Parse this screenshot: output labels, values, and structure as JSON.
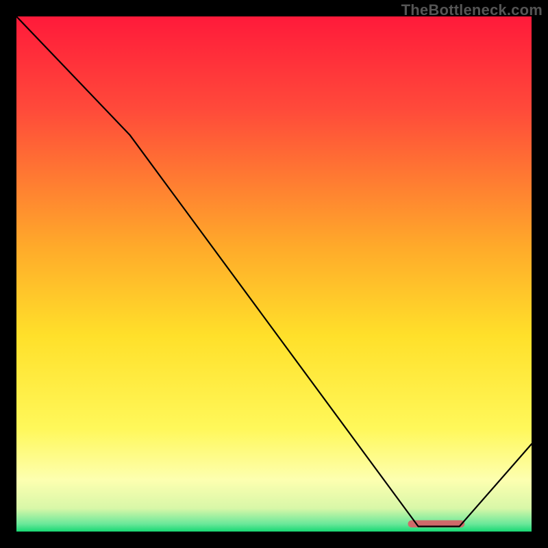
{
  "watermark": "TheBottleneck.com",
  "chart_data": {
    "type": "line",
    "title": "",
    "xlabel": "",
    "ylabel": "",
    "xlim": [
      0,
      100
    ],
    "ylim": [
      0,
      100
    ],
    "grid": false,
    "legend": false,
    "series": [
      {
        "name": "bottleneck-curve",
        "x": [
          0,
          22,
          78,
          86,
          100
        ],
        "values": [
          100,
          77,
          1,
          1,
          17
        ]
      }
    ],
    "marker": {
      "name": "optimal-range",
      "x_start": 76,
      "x_end": 87,
      "y": 1.5,
      "color": "#cf6a6a"
    },
    "background_gradient_stops": [
      {
        "offset": 0.0,
        "color": "#ff1a3a"
      },
      {
        "offset": 0.18,
        "color": "#ff4a3a"
      },
      {
        "offset": 0.45,
        "color": "#ffab2a"
      },
      {
        "offset": 0.62,
        "color": "#ffe02a"
      },
      {
        "offset": 0.8,
        "color": "#fff85a"
      },
      {
        "offset": 0.9,
        "color": "#fdffb0"
      },
      {
        "offset": 0.955,
        "color": "#d8f7a8"
      },
      {
        "offset": 0.985,
        "color": "#6be89a"
      },
      {
        "offset": 1.0,
        "color": "#18d873"
      }
    ]
  }
}
